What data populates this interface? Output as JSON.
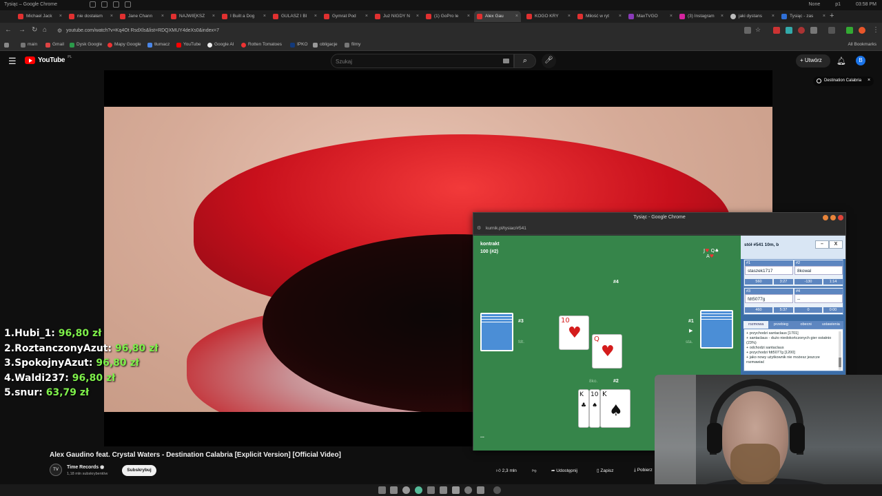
{
  "os_bar": {
    "window_title": "Tysiąc – Google Chrome",
    "weather": "None",
    "user": "p1",
    "clock": "03:58 PM"
  },
  "tabs": [
    {
      "label": "Michael Jack",
      "active": false
    },
    {
      "label": "nie dostałam",
      "active": false
    },
    {
      "label": "Jane Chann",
      "active": false
    },
    {
      "label": "NAJWIĘKSZ",
      "active": false
    },
    {
      "label": "I Built a Dog",
      "active": false
    },
    {
      "label": "GULASZ I BI",
      "active": false
    },
    {
      "label": "Gymrat Pod",
      "active": false
    },
    {
      "label": "Już NIGDY N",
      "active": false
    },
    {
      "label": "(1) GoPro le",
      "active": false
    },
    {
      "label": "Alex Gau",
      "active": true
    },
    {
      "label": "KOGO KRY",
      "active": false
    },
    {
      "label": "Miłość w ryt",
      "active": false
    },
    {
      "label": "MaxTVGO",
      "active": false
    },
    {
      "label": "(3) Instagram",
      "active": false
    },
    {
      "label": "jaki dystans",
      "active": false
    },
    {
      "label": "Tysiąc - zas",
      "active": false
    }
  ],
  "toolbar": {
    "url": "youtube.com/watch?v=Kq4Ot RsdXls&list=RDQXMUY4deXs0&index=7"
  },
  "bookmarks": {
    "items": [
      "main",
      "Gmail",
      "Dysk Google",
      "Mapy Google",
      "tłumacz",
      "YouTube",
      "Google AI",
      "Rotten Tomatoes",
      "IPKO",
      "obligacje",
      "filmy"
    ],
    "all_label": "All Bookmarks"
  },
  "youtube": {
    "logo_text": "YouTube",
    "region": "PL",
    "search_placeholder": "Szukaj",
    "create_label": "Utwórz",
    "avatar_letter": "B",
    "destination_chip": "Destination Calabria",
    "video_title": "Alex Gaudino feat. Crystal Waters - Destination Calabria [Explicit Version] [Official Video]",
    "channel_name": "Time Records",
    "channel_subs": "1,18 mln subskrybentów",
    "subscribe_label": "Subskrybuj",
    "likes": "2,3 mln",
    "share_label": "Udostępnij",
    "save_label": "Zapisz",
    "download_label": "Pobierz"
  },
  "leaderboard": [
    {
      "rank": "1.",
      "name": "Hubi_1:",
      "amount": "96,80 zł"
    },
    {
      "rank": "2.",
      "name": "RoztanczonyAzut:",
      "amount": "96,80 zł"
    },
    {
      "rank": "3.",
      "name": "SpokojnyAzut:",
      "amount": "96,80 zł"
    },
    {
      "rank": "4.",
      "name": "Waldi237:",
      "amount": "96,80 zł"
    },
    {
      "rank": "5.",
      "name": "snur:",
      "amount": "63,79 zł"
    }
  ],
  "game": {
    "window_title": "Tysiąc - Google Chrome",
    "url": "kurnik.pl/tysiac/#541",
    "contract_label": "kontrakt",
    "contract_value": "100 (#2)",
    "seat4": "#4",
    "seat3": "#3",
    "seat3_name": "fdt.",
    "seat1": "#1",
    "seat1_name": "sta.",
    "seat2": "#2",
    "seat2_name": "8ko.",
    "trick_cards": [
      {
        "rank": "10",
        "suit": "♥"
      },
      {
        "rank": "Q",
        "suit": "♥"
      }
    ],
    "hand_cards": [
      {
        "rank": "K",
        "suit": "♣"
      },
      {
        "rank": "10",
        "suit": "♠"
      },
      {
        "rank": "K",
        "suit": "♠"
      }
    ],
    "musik": {
      "line1": "J",
      "line1b": "Q",
      "line2": "A"
    },
    "more": "...",
    "side": {
      "table": "stół #541   10m, b",
      "min_btn": "–",
      "close_btn": "X",
      "players": [
        {
          "num": "#1",
          "name": "staszek1717",
          "score": "560",
          "time": "3:27"
        },
        {
          "num": "#2",
          "name": "8kowal",
          "score": "-130",
          "time": "1:14"
        },
        {
          "num": "#3",
          "name": "fdt5077g",
          "score": "460",
          "time": "5:37"
        },
        {
          "num": "#4",
          "name": "--",
          "score": "0",
          "time": "0:00"
        }
      ],
      "tabs": [
        "rozmowa",
        "przebieg",
        "obecni",
        "ustawienia"
      ],
      "chat": [
        "+ przychodzi santaclaus [1701]",
        "+ santaclaus - dużo niedokończonych gier ostatnio (23%)",
        "+ odchodzi santaclaus",
        "+ przychodzi fdt5077g [1200]",
        "+ jako nowy użytkownik nie możesz jeszcze rozmawiać"
      ]
    }
  },
  "colors": {
    "table_green": "#36854a",
    "side_blue": "#3c6ea8",
    "leaderboard_amount": "#7ef04a",
    "yt_red": "#ff0000"
  }
}
